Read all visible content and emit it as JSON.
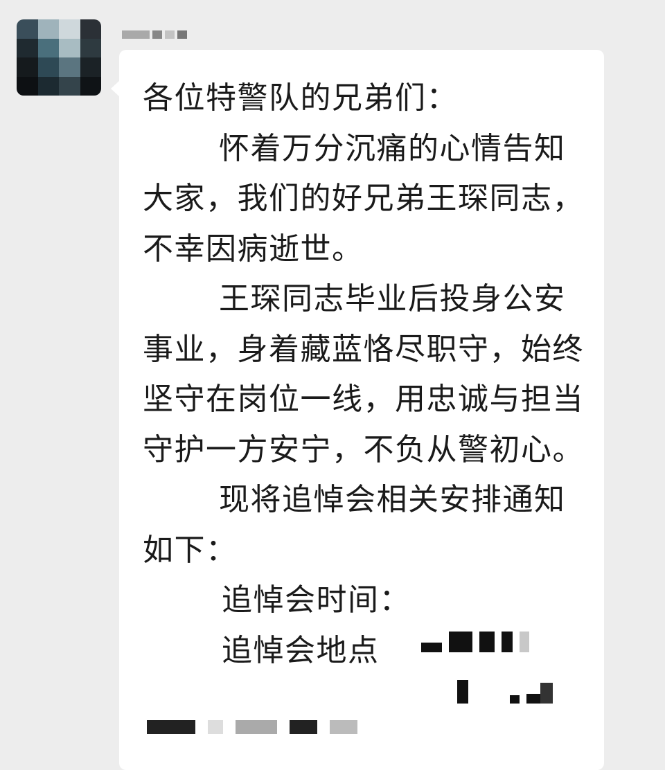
{
  "chat": {
    "message": {
      "greeting": "各位特警队的兄弟们：",
      "paragraph1": "怀着万分沉痛的心情告知大家，我们的好兄弟王琛同志，不幸因病逝世。",
      "paragraph2": "王琛同志毕业后投身公安事业，身着藏蓝恪尽职守，始终坚守在岗位一线，用忠诚与担当守护一方安宁，不负从警初心。",
      "paragraph3": "现将追悼会相关安排通知如下：",
      "time_label": "追悼会时间：",
      "location_label": "追悼会地点"
    }
  },
  "colors": {
    "background": "#ededed",
    "bubble": "#ffffff",
    "text": "#1a1a1a"
  }
}
